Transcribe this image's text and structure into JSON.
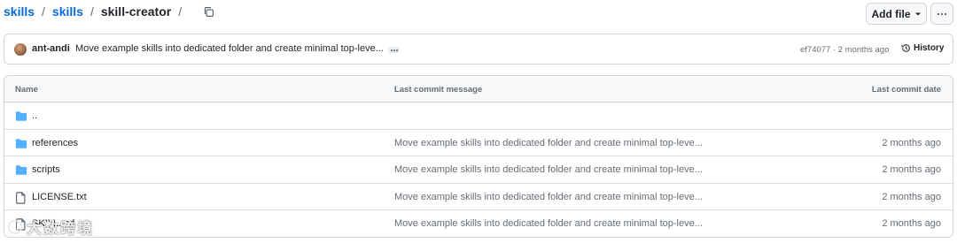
{
  "breadcrumb": {
    "items": [
      "skills",
      "skills"
    ],
    "current": "skill-creator",
    "separator": "/"
  },
  "toolbar": {
    "add_file_label": "Add file",
    "more_label": "···"
  },
  "commit": {
    "author": "ant-andi",
    "message": "Move example skills into dedicated folder and create minimal top-leve...",
    "hash_time": "ef74077 · 2 months ago",
    "history_label": "History"
  },
  "table": {
    "headers": {
      "name": "Name",
      "message": "Last commit message",
      "date": "Last commit date"
    },
    "rows": [
      {
        "icon": "folder-icon",
        "name": "..",
        "message": "",
        "date": ""
      },
      {
        "icon": "folder-icon",
        "name": "references",
        "message": "Move example skills into dedicated folder and create minimal top-leve...",
        "date": "2 months ago"
      },
      {
        "icon": "folder-icon",
        "name": "scripts",
        "message": "Move example skills into dedicated folder and create minimal top-leve...",
        "date": "2 months ago"
      },
      {
        "icon": "file-icon",
        "name": "LICENSE.txt",
        "message": "Move example skills into dedicated folder and create minimal top-leve...",
        "date": "2 months ago"
      },
      {
        "icon": "file-icon",
        "name": "SKILL.md",
        "message": "Move example skills into dedicated folder and create minimal top-leve...",
        "date": "2 months ago"
      }
    ]
  },
  "watermark": "大数跨境",
  "colors": {
    "link": "#0969da",
    "folder": "#54aeff",
    "border": "#d0d7de",
    "header_bg": "#f6f8fa",
    "muted_text": "#656d76"
  }
}
